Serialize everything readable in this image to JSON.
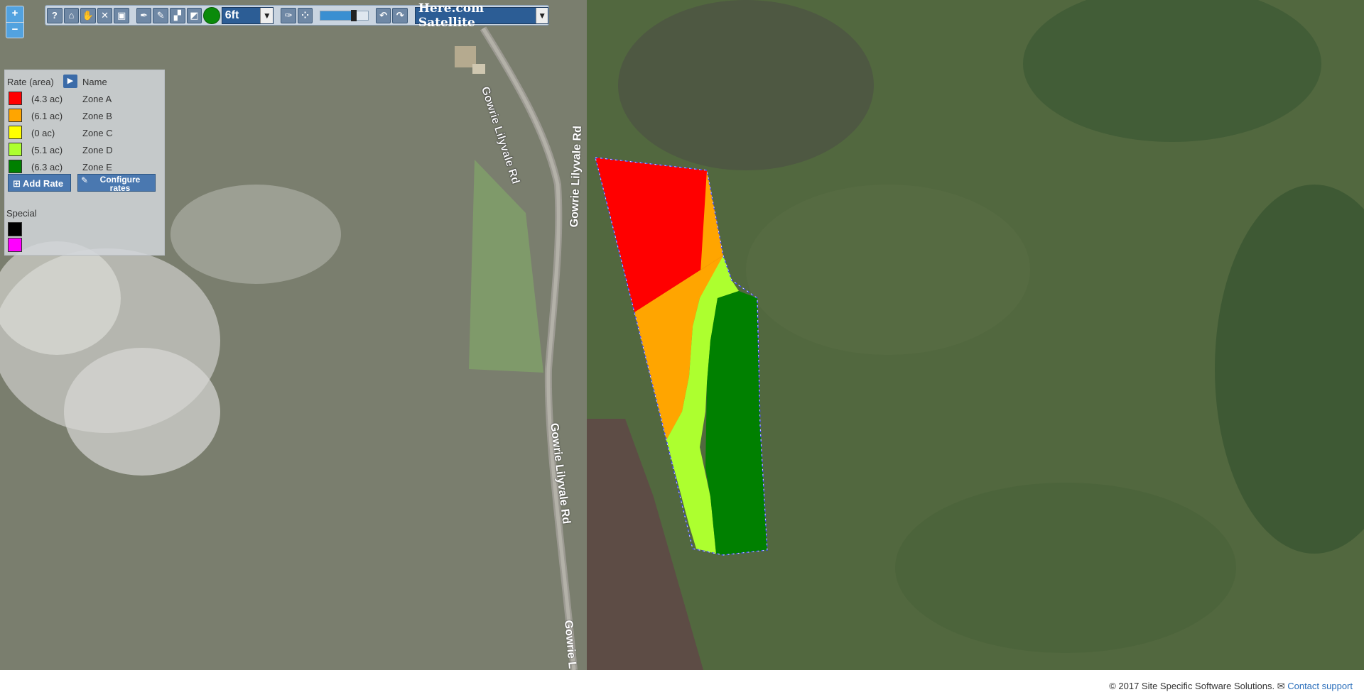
{
  "toolbar": {
    "icons": [
      "help-icon",
      "home-icon",
      "pan-hand-icon",
      "close-icon",
      "save-icon",
      "pencil-icon",
      "pen-icon",
      "eraser-icon",
      "eraser-alt-icon"
    ],
    "brush_size": "6ft",
    "color_active": "#0a8a0a",
    "opacity_level": 0.7,
    "basemap": "Here.com Satellite"
  },
  "zoom": {
    "in_label": "+",
    "out_label": "−"
  },
  "legend": {
    "header_rate": "Rate (area)",
    "header_name": "Name",
    "zones": [
      {
        "color": "#ff0000",
        "area": "(4.3 ac)",
        "name": "Zone A"
      },
      {
        "color": "#ffa500",
        "area": "(6.1 ac)",
        "name": "Zone B"
      },
      {
        "color": "#ffff00",
        "area": "(0 ac)",
        "name": "Zone C"
      },
      {
        "color": "#adff2f",
        "area": "(5.1 ac)",
        "name": "Zone D"
      },
      {
        "color": "#008000",
        "area": "(6.3 ac)",
        "name": "Zone E"
      }
    ],
    "add_rate_label": "Add Rate",
    "configure_label_1": "Configure",
    "configure_label_2": "rates",
    "special_label": "Special",
    "special_colors": [
      "#000000",
      "#ff00ff"
    ]
  },
  "map": {
    "road_labels": [
      "Gowrie Lilyvale Rd",
      "Gowrie Lilyvale Rd",
      "Gowrie Lilyvale Rd",
      "Gowrie L"
    ]
  },
  "footer": {
    "copyright": "© 2017 Site Specific Software Solutions.",
    "contact": "Contact support"
  }
}
